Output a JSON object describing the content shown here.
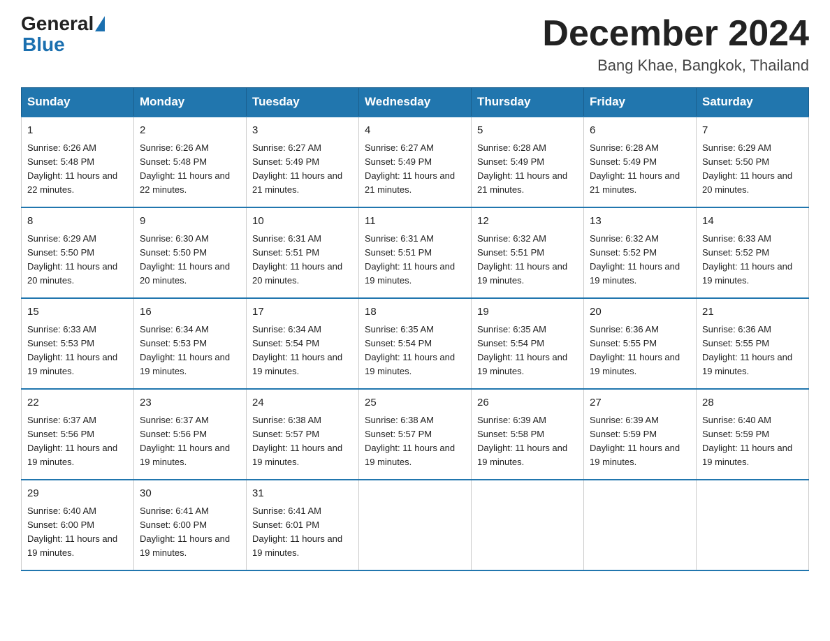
{
  "logo": {
    "general": "General",
    "blue": "Blue"
  },
  "title": "December 2024",
  "location": "Bang Khae, Bangkok, Thailand",
  "headers": [
    "Sunday",
    "Monday",
    "Tuesday",
    "Wednesday",
    "Thursday",
    "Friday",
    "Saturday"
  ],
  "weeks": [
    [
      {
        "day": "1",
        "sunrise": "6:26 AM",
        "sunset": "5:48 PM",
        "daylight": "11 hours and 22 minutes."
      },
      {
        "day": "2",
        "sunrise": "6:26 AM",
        "sunset": "5:48 PM",
        "daylight": "11 hours and 22 minutes."
      },
      {
        "day": "3",
        "sunrise": "6:27 AM",
        "sunset": "5:49 PM",
        "daylight": "11 hours and 21 minutes."
      },
      {
        "day": "4",
        "sunrise": "6:27 AM",
        "sunset": "5:49 PM",
        "daylight": "11 hours and 21 minutes."
      },
      {
        "day": "5",
        "sunrise": "6:28 AM",
        "sunset": "5:49 PM",
        "daylight": "11 hours and 21 minutes."
      },
      {
        "day": "6",
        "sunrise": "6:28 AM",
        "sunset": "5:49 PM",
        "daylight": "11 hours and 21 minutes."
      },
      {
        "day": "7",
        "sunrise": "6:29 AM",
        "sunset": "5:50 PM",
        "daylight": "11 hours and 20 minutes."
      }
    ],
    [
      {
        "day": "8",
        "sunrise": "6:29 AM",
        "sunset": "5:50 PM",
        "daylight": "11 hours and 20 minutes."
      },
      {
        "day": "9",
        "sunrise": "6:30 AM",
        "sunset": "5:50 PM",
        "daylight": "11 hours and 20 minutes."
      },
      {
        "day": "10",
        "sunrise": "6:31 AM",
        "sunset": "5:51 PM",
        "daylight": "11 hours and 20 minutes."
      },
      {
        "day": "11",
        "sunrise": "6:31 AM",
        "sunset": "5:51 PM",
        "daylight": "11 hours and 19 minutes."
      },
      {
        "day": "12",
        "sunrise": "6:32 AM",
        "sunset": "5:51 PM",
        "daylight": "11 hours and 19 minutes."
      },
      {
        "day": "13",
        "sunrise": "6:32 AM",
        "sunset": "5:52 PM",
        "daylight": "11 hours and 19 minutes."
      },
      {
        "day": "14",
        "sunrise": "6:33 AM",
        "sunset": "5:52 PM",
        "daylight": "11 hours and 19 minutes."
      }
    ],
    [
      {
        "day": "15",
        "sunrise": "6:33 AM",
        "sunset": "5:53 PM",
        "daylight": "11 hours and 19 minutes."
      },
      {
        "day": "16",
        "sunrise": "6:34 AM",
        "sunset": "5:53 PM",
        "daylight": "11 hours and 19 minutes."
      },
      {
        "day": "17",
        "sunrise": "6:34 AM",
        "sunset": "5:54 PM",
        "daylight": "11 hours and 19 minutes."
      },
      {
        "day": "18",
        "sunrise": "6:35 AM",
        "sunset": "5:54 PM",
        "daylight": "11 hours and 19 minutes."
      },
      {
        "day": "19",
        "sunrise": "6:35 AM",
        "sunset": "5:54 PM",
        "daylight": "11 hours and 19 minutes."
      },
      {
        "day": "20",
        "sunrise": "6:36 AM",
        "sunset": "5:55 PM",
        "daylight": "11 hours and 19 minutes."
      },
      {
        "day": "21",
        "sunrise": "6:36 AM",
        "sunset": "5:55 PM",
        "daylight": "11 hours and 19 minutes."
      }
    ],
    [
      {
        "day": "22",
        "sunrise": "6:37 AM",
        "sunset": "5:56 PM",
        "daylight": "11 hours and 19 minutes."
      },
      {
        "day": "23",
        "sunrise": "6:37 AM",
        "sunset": "5:56 PM",
        "daylight": "11 hours and 19 minutes."
      },
      {
        "day": "24",
        "sunrise": "6:38 AM",
        "sunset": "5:57 PM",
        "daylight": "11 hours and 19 minutes."
      },
      {
        "day": "25",
        "sunrise": "6:38 AM",
        "sunset": "5:57 PM",
        "daylight": "11 hours and 19 minutes."
      },
      {
        "day": "26",
        "sunrise": "6:39 AM",
        "sunset": "5:58 PM",
        "daylight": "11 hours and 19 minutes."
      },
      {
        "day": "27",
        "sunrise": "6:39 AM",
        "sunset": "5:59 PM",
        "daylight": "11 hours and 19 minutes."
      },
      {
        "day": "28",
        "sunrise": "6:40 AM",
        "sunset": "5:59 PM",
        "daylight": "11 hours and 19 minutes."
      }
    ],
    [
      {
        "day": "29",
        "sunrise": "6:40 AM",
        "sunset": "6:00 PM",
        "daylight": "11 hours and 19 minutes."
      },
      {
        "day": "30",
        "sunrise": "6:41 AM",
        "sunset": "6:00 PM",
        "daylight": "11 hours and 19 minutes."
      },
      {
        "day": "31",
        "sunrise": "6:41 AM",
        "sunset": "6:01 PM",
        "daylight": "11 hours and 19 minutes."
      },
      null,
      null,
      null,
      null
    ]
  ],
  "labels": {
    "sunrise": "Sunrise:",
    "sunset": "Sunset:",
    "daylight": "Daylight:"
  }
}
